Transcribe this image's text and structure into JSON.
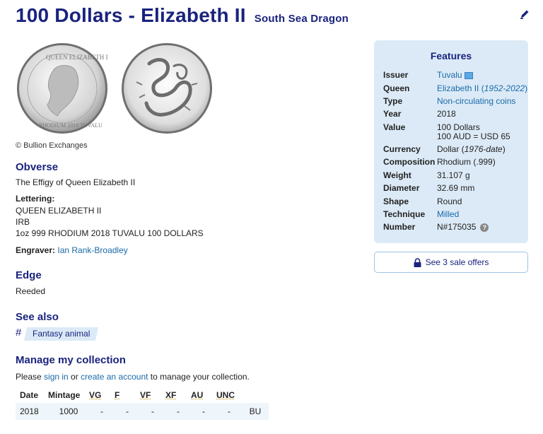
{
  "header": {
    "title": "100 Dollars - Elizabeth II",
    "subtitle": "South Sea Dragon",
    "edit_icon": "pencil-icon"
  },
  "images": {
    "obverse_alt": "Obverse coin image",
    "reverse_alt": "Reverse coin image",
    "credit": "© Bullion Exchanges"
  },
  "obverse": {
    "heading": "Obverse",
    "description": "The Effigy of Queen Elizabeth II",
    "lettering_label": "Lettering:",
    "lettering": [
      "QUEEN ELIZABETH II",
      "IRB",
      "1oz 999 RHODIUM 2018 TUVALU 100 DOLLARS"
    ],
    "engraver_label": "Engraver:",
    "engraver": "Ian Rank-Broadley"
  },
  "edge": {
    "heading": "Edge",
    "text": "Reeded"
  },
  "see_also": {
    "heading": "See also",
    "hash": "#",
    "tag": "Fantasy animal"
  },
  "collection": {
    "heading": "Manage my collection",
    "text_before": "Please ",
    "sign_in": "sign in",
    "text_mid": " or ",
    "create_account": "create an account",
    "text_after": " to manage your collection.",
    "columns": [
      "Date",
      "Mintage",
      "VG",
      "F",
      "VF",
      "XF",
      "AU",
      "UNC",
      ""
    ],
    "rows": [
      [
        "2018",
        "1000",
        "-",
        "-",
        "-",
        "-",
        "-",
        "-",
        "BU"
      ]
    ]
  },
  "features": {
    "heading": "Features",
    "rows": [
      {
        "key": "Issuer",
        "value": "Tuvalu",
        "flag": true
      },
      {
        "key": "Queen",
        "value": "Elizabeth II",
        "extra": "1952-2022"
      },
      {
        "key": "Type",
        "value": "Non-circulating coins"
      },
      {
        "key": "Year",
        "value": "2018"
      },
      {
        "key": "Value",
        "value": "100 Dollars",
        "line2": "100 AUD = USD 65"
      },
      {
        "key": "Currency",
        "value": "Dollar",
        "extra": "1976-date"
      },
      {
        "key": "Composition",
        "value": "Rhodium (.999)"
      },
      {
        "key": "Weight",
        "value": "31.107 g"
      },
      {
        "key": "Diameter",
        "value": "32.69 mm"
      },
      {
        "key": "Shape",
        "value": "Round"
      },
      {
        "key": "Technique",
        "value": "Milled"
      },
      {
        "key": "Number",
        "value": "N#175035",
        "help": "?"
      }
    ]
  },
  "offers_button": {
    "label": "See 3 sale offers",
    "icon": "lock-icon"
  },
  "colors": {
    "heading": "#1a237e",
    "link": "#1a6aa8",
    "panel": "#dceaf7"
  }
}
